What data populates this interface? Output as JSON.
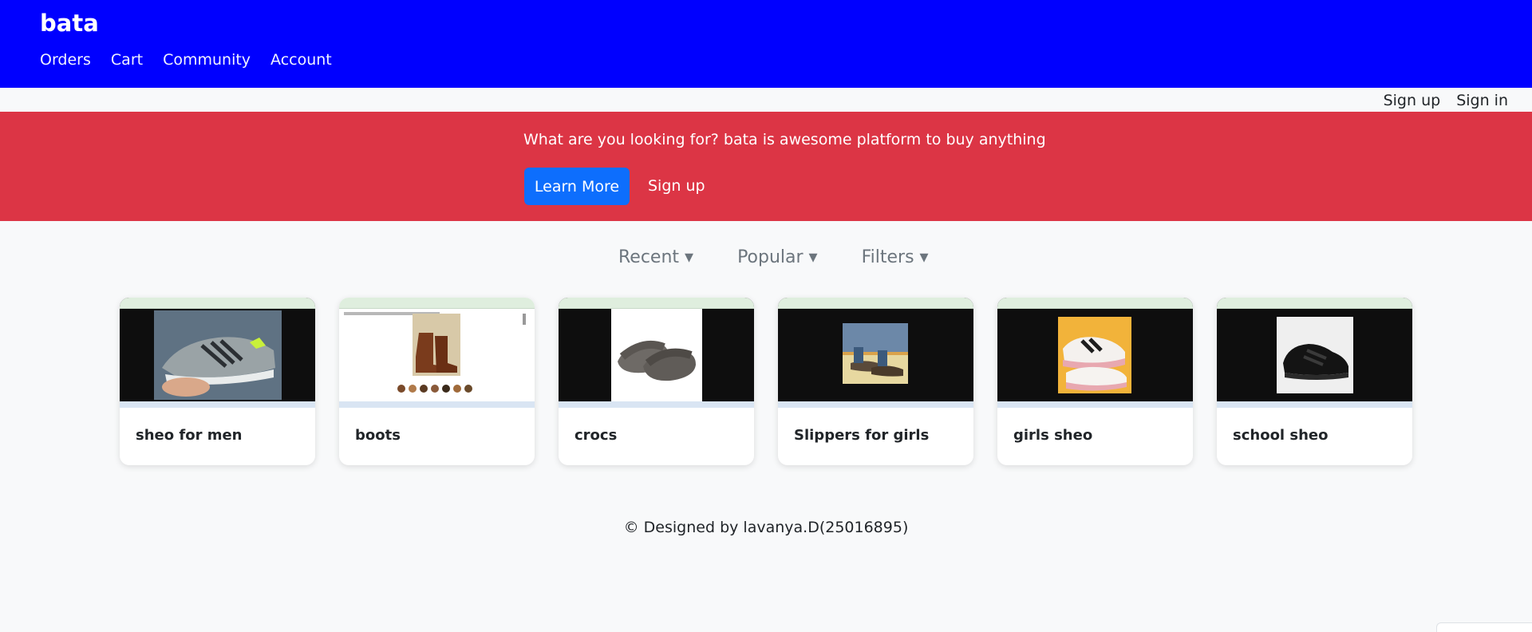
{
  "header": {
    "brand": "bata",
    "nav": [
      "Orders",
      "Cart",
      "Community",
      "Account"
    ],
    "background": "#0000ff"
  },
  "auth": {
    "signup": "Sign up",
    "signin": "Sign in"
  },
  "hero": {
    "text": "What are you looking for? bata is awesome platform to buy anything",
    "learn_more": "Learn More",
    "signup": "Sign up",
    "background": "#dc3545",
    "button_color": "#0d6efd"
  },
  "sort": {
    "recent": "Recent ▾",
    "popular": "Popular ▾",
    "filters": "Filters ▾"
  },
  "products": [
    {
      "title": "sheo for men",
      "image": "grey-sneaker-icon"
    },
    {
      "title": "boots",
      "image": "brown-boot-icon"
    },
    {
      "title": "crocs",
      "image": "grey-slide-icon"
    },
    {
      "title": "Slippers for girls",
      "image": "sandal-icon"
    },
    {
      "title": "girls sheo",
      "image": "white-sneaker-icon"
    },
    {
      "title": "school sheo",
      "image": "black-school-shoe-icon"
    }
  ],
  "footer": {
    "text": "© Designed by lavanya.D(25016895)"
  }
}
